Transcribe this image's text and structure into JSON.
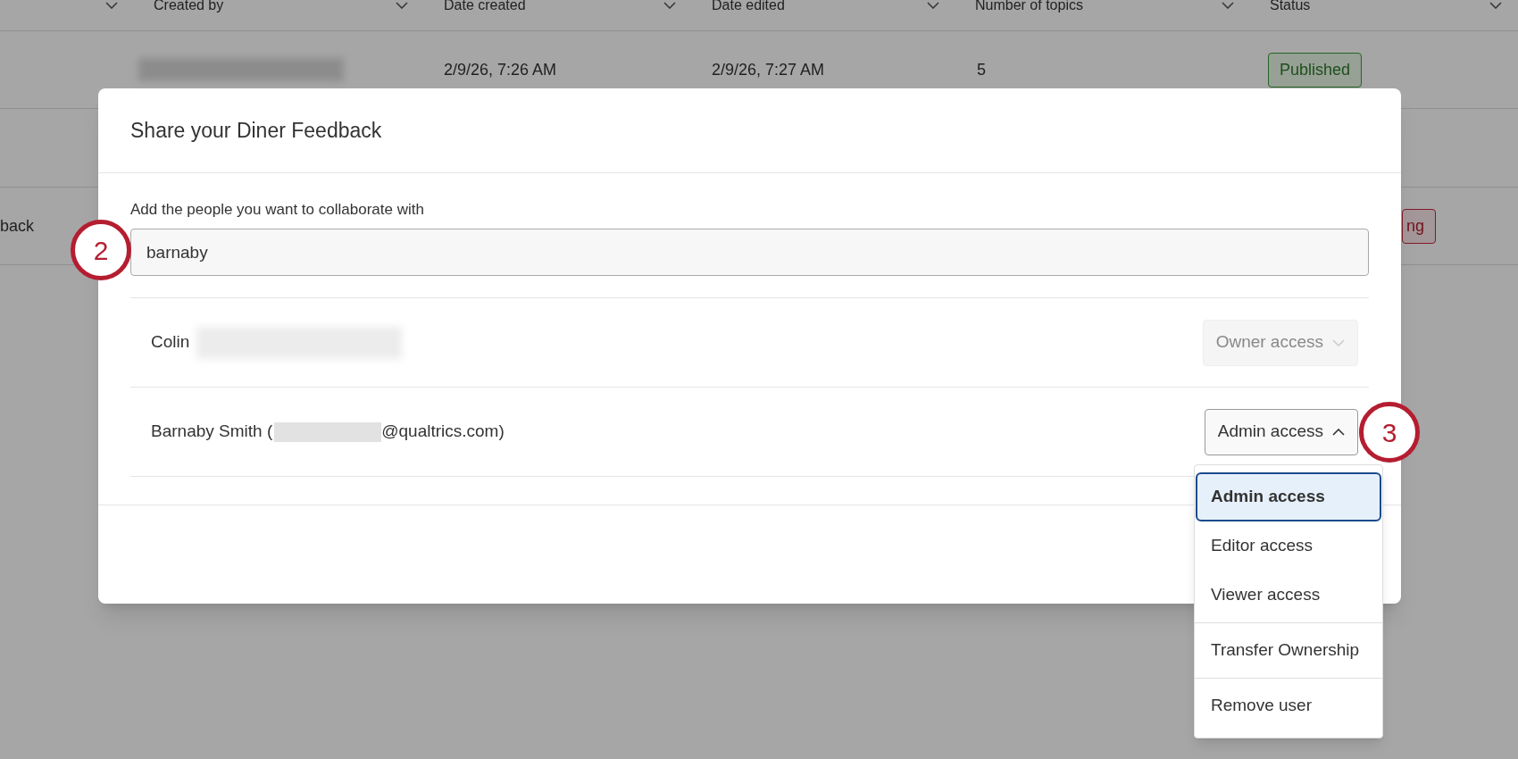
{
  "table": {
    "columns": [
      {},
      {
        "label": "Created by"
      },
      {
        "label": "Date created"
      },
      {
        "label": "Date edited"
      },
      {
        "label": "Number of topics"
      },
      {
        "label": "Status"
      }
    ],
    "rows": [
      {
        "created_by_redacted": true,
        "date_created": "2/9/26, 7:26 AM",
        "date_edited": "2/9/26, 7:27 AM",
        "topics": "5",
        "status": {
          "text": "Published",
          "kind": "success"
        }
      },
      {
        "created_by_redacted": false
      },
      {
        "name": "back",
        "created_by_redacted": false,
        "status": {
          "text": "ng",
          "kind": "error"
        }
      }
    ]
  },
  "dialog": {
    "title": "Share your Diner Feedback",
    "field_label": "Add the people you want to collaborate with",
    "search_value": "barnaby",
    "collaborators": [
      {
        "label_start": "Colin",
        "access": "Owner access",
        "disabled": true,
        "expanded": false
      },
      {
        "label_start": "Barnaby Smith (",
        "label_end": "@qualtrics.com)",
        "access": "Admin access",
        "disabled": false,
        "expanded": true
      }
    ],
    "menu": [
      {
        "label": "Admin access",
        "selected": true,
        "divider_before": false
      },
      {
        "label": "Editor access",
        "selected": false,
        "divider_before": false
      },
      {
        "label": "Viewer access",
        "selected": false,
        "divider_before": false
      },
      {
        "label": "Transfer Ownership",
        "selected": false,
        "divider_before": true
      },
      {
        "label": "Remove user",
        "selected": false,
        "divider_before": true
      }
    ]
  },
  "callouts": [
    {
      "number": "2"
    },
    {
      "number": "3"
    }
  ]
}
